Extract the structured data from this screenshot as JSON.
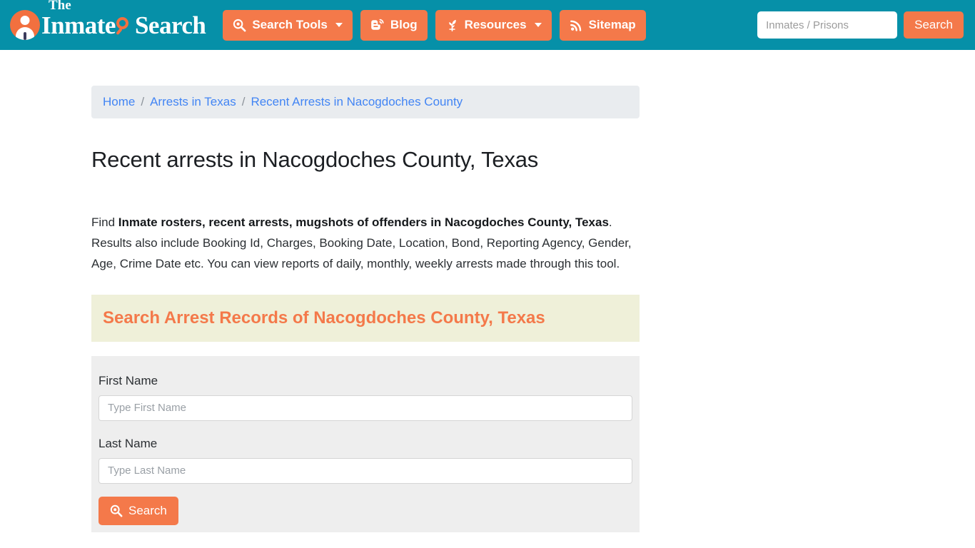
{
  "header": {
    "logo": {
      "icon": "inmate-avatar-icon",
      "the": "The",
      "word1": "Inmate",
      "glass_icon": "magnifier-icon",
      "word2": "Search"
    },
    "nav": [
      {
        "label": "Search Tools",
        "icon": "magnifier-icon",
        "caret": true
      },
      {
        "label": "Blog",
        "icon": "blogger-icon",
        "caret": false
      },
      {
        "label": "Resources",
        "icon": "leaf-icon",
        "caret": true
      },
      {
        "label": "Sitemap",
        "icon": "rss-icon",
        "caret": false
      }
    ],
    "search": {
      "placeholder": "Inmates / Prisons",
      "value": "",
      "button_label": "Search"
    }
  },
  "breadcrumb": {
    "items": [
      {
        "label": "Home",
        "link": true
      },
      {
        "label": "Arrests in Texas",
        "link": true
      },
      {
        "label": "Recent Arrests in Nacogdoches County",
        "link": true
      }
    ],
    "separator": "/"
  },
  "main": {
    "page_title": "Recent arrests in Nacogdoches County, Texas",
    "lede": {
      "prefix": "Find ",
      "bold": "Inmate rosters, recent arrests, mugshots of offenders in Nacogdoches County, Texas",
      "suffix": ". Results also include Booking Id, Charges, Booking Date, Location, Bond, Reporting Agency, Gender, Age, Crime Date etc. You can view reports of daily, monthly, weekly arrests made through this tool."
    },
    "section_heading": "Search Arrest Records of Nacogdoches County, Texas",
    "form": {
      "fields": [
        {
          "label": "First Name",
          "placeholder": "Type First Name",
          "value": ""
        },
        {
          "label": "Last Name",
          "placeholder": "Type Last Name",
          "value": ""
        }
      ],
      "submit_label": "Search",
      "submit_icon": "magnifier-icon"
    }
  },
  "colors": {
    "header_teal": "#0690a8",
    "accent_orange": "#f4794a",
    "breadcrumb_bg": "#e9ecef",
    "section_bg": "#eff0d9",
    "panel_bg": "#eeeeee",
    "link_blue": "#4285f4"
  }
}
